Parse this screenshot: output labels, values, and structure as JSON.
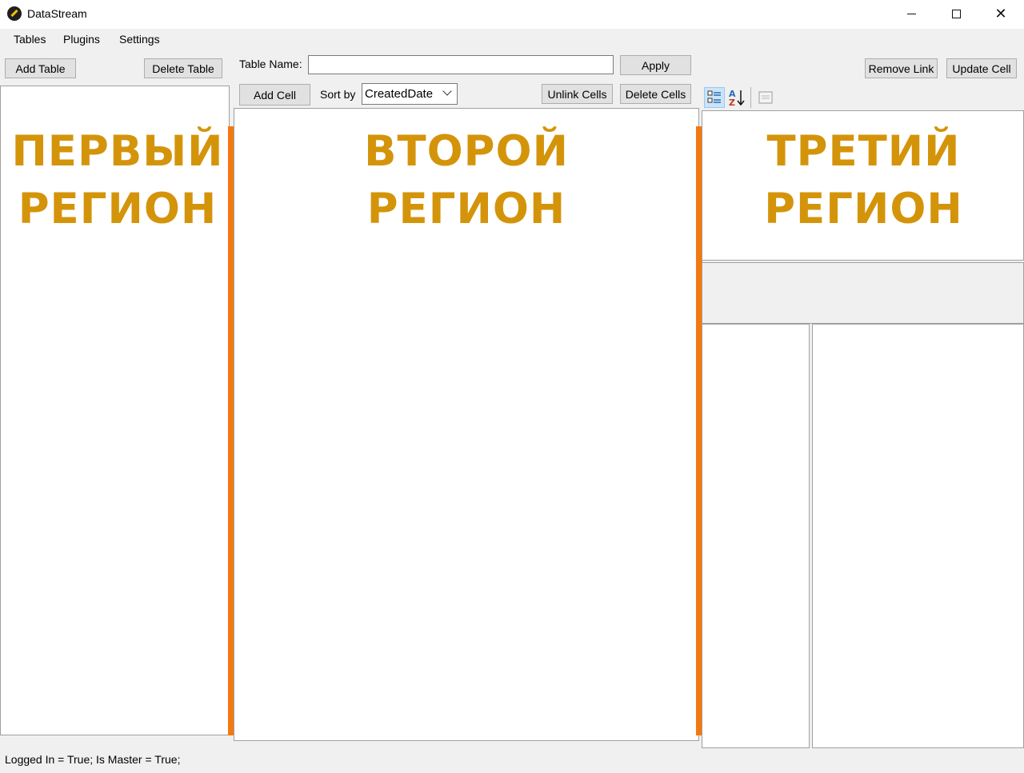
{
  "window": {
    "title": "DataStream"
  },
  "menu": {
    "tables": "Tables",
    "plugins": "Plugins",
    "settings": "Settings"
  },
  "left_toolbar": {
    "add_table": "Add Table",
    "delete_table": "Delete Table"
  },
  "center_toolbar": {
    "table_name_label": "Table Name:",
    "table_name_value": "",
    "apply": "Apply",
    "add_cell": "Add Cell",
    "sort_by_label": "Sort by",
    "sort_by_value": "CreatedDate",
    "unlink_cells": "Unlink Cells",
    "delete_cells": "Delete Cells"
  },
  "right_toolbar": {
    "remove_link": "Remove Link",
    "update_cell": "Update Cell",
    "icons": [
      "categorized-view-icon",
      "alphabetical-sort-icon",
      "property-pages-icon"
    ]
  },
  "regions": {
    "first": [
      "ПЕРВЫЙ",
      "РЕГИОН"
    ],
    "second": [
      "ВТОРОЙ",
      "РЕГИОН"
    ],
    "third": [
      "ТРЕТИЙ",
      "РЕГИОН"
    ]
  },
  "status": {
    "text": "Logged In = True; Is Master = True;"
  },
  "colors": {
    "region_label": "#d4940a",
    "splitter": "#f5780f"
  }
}
